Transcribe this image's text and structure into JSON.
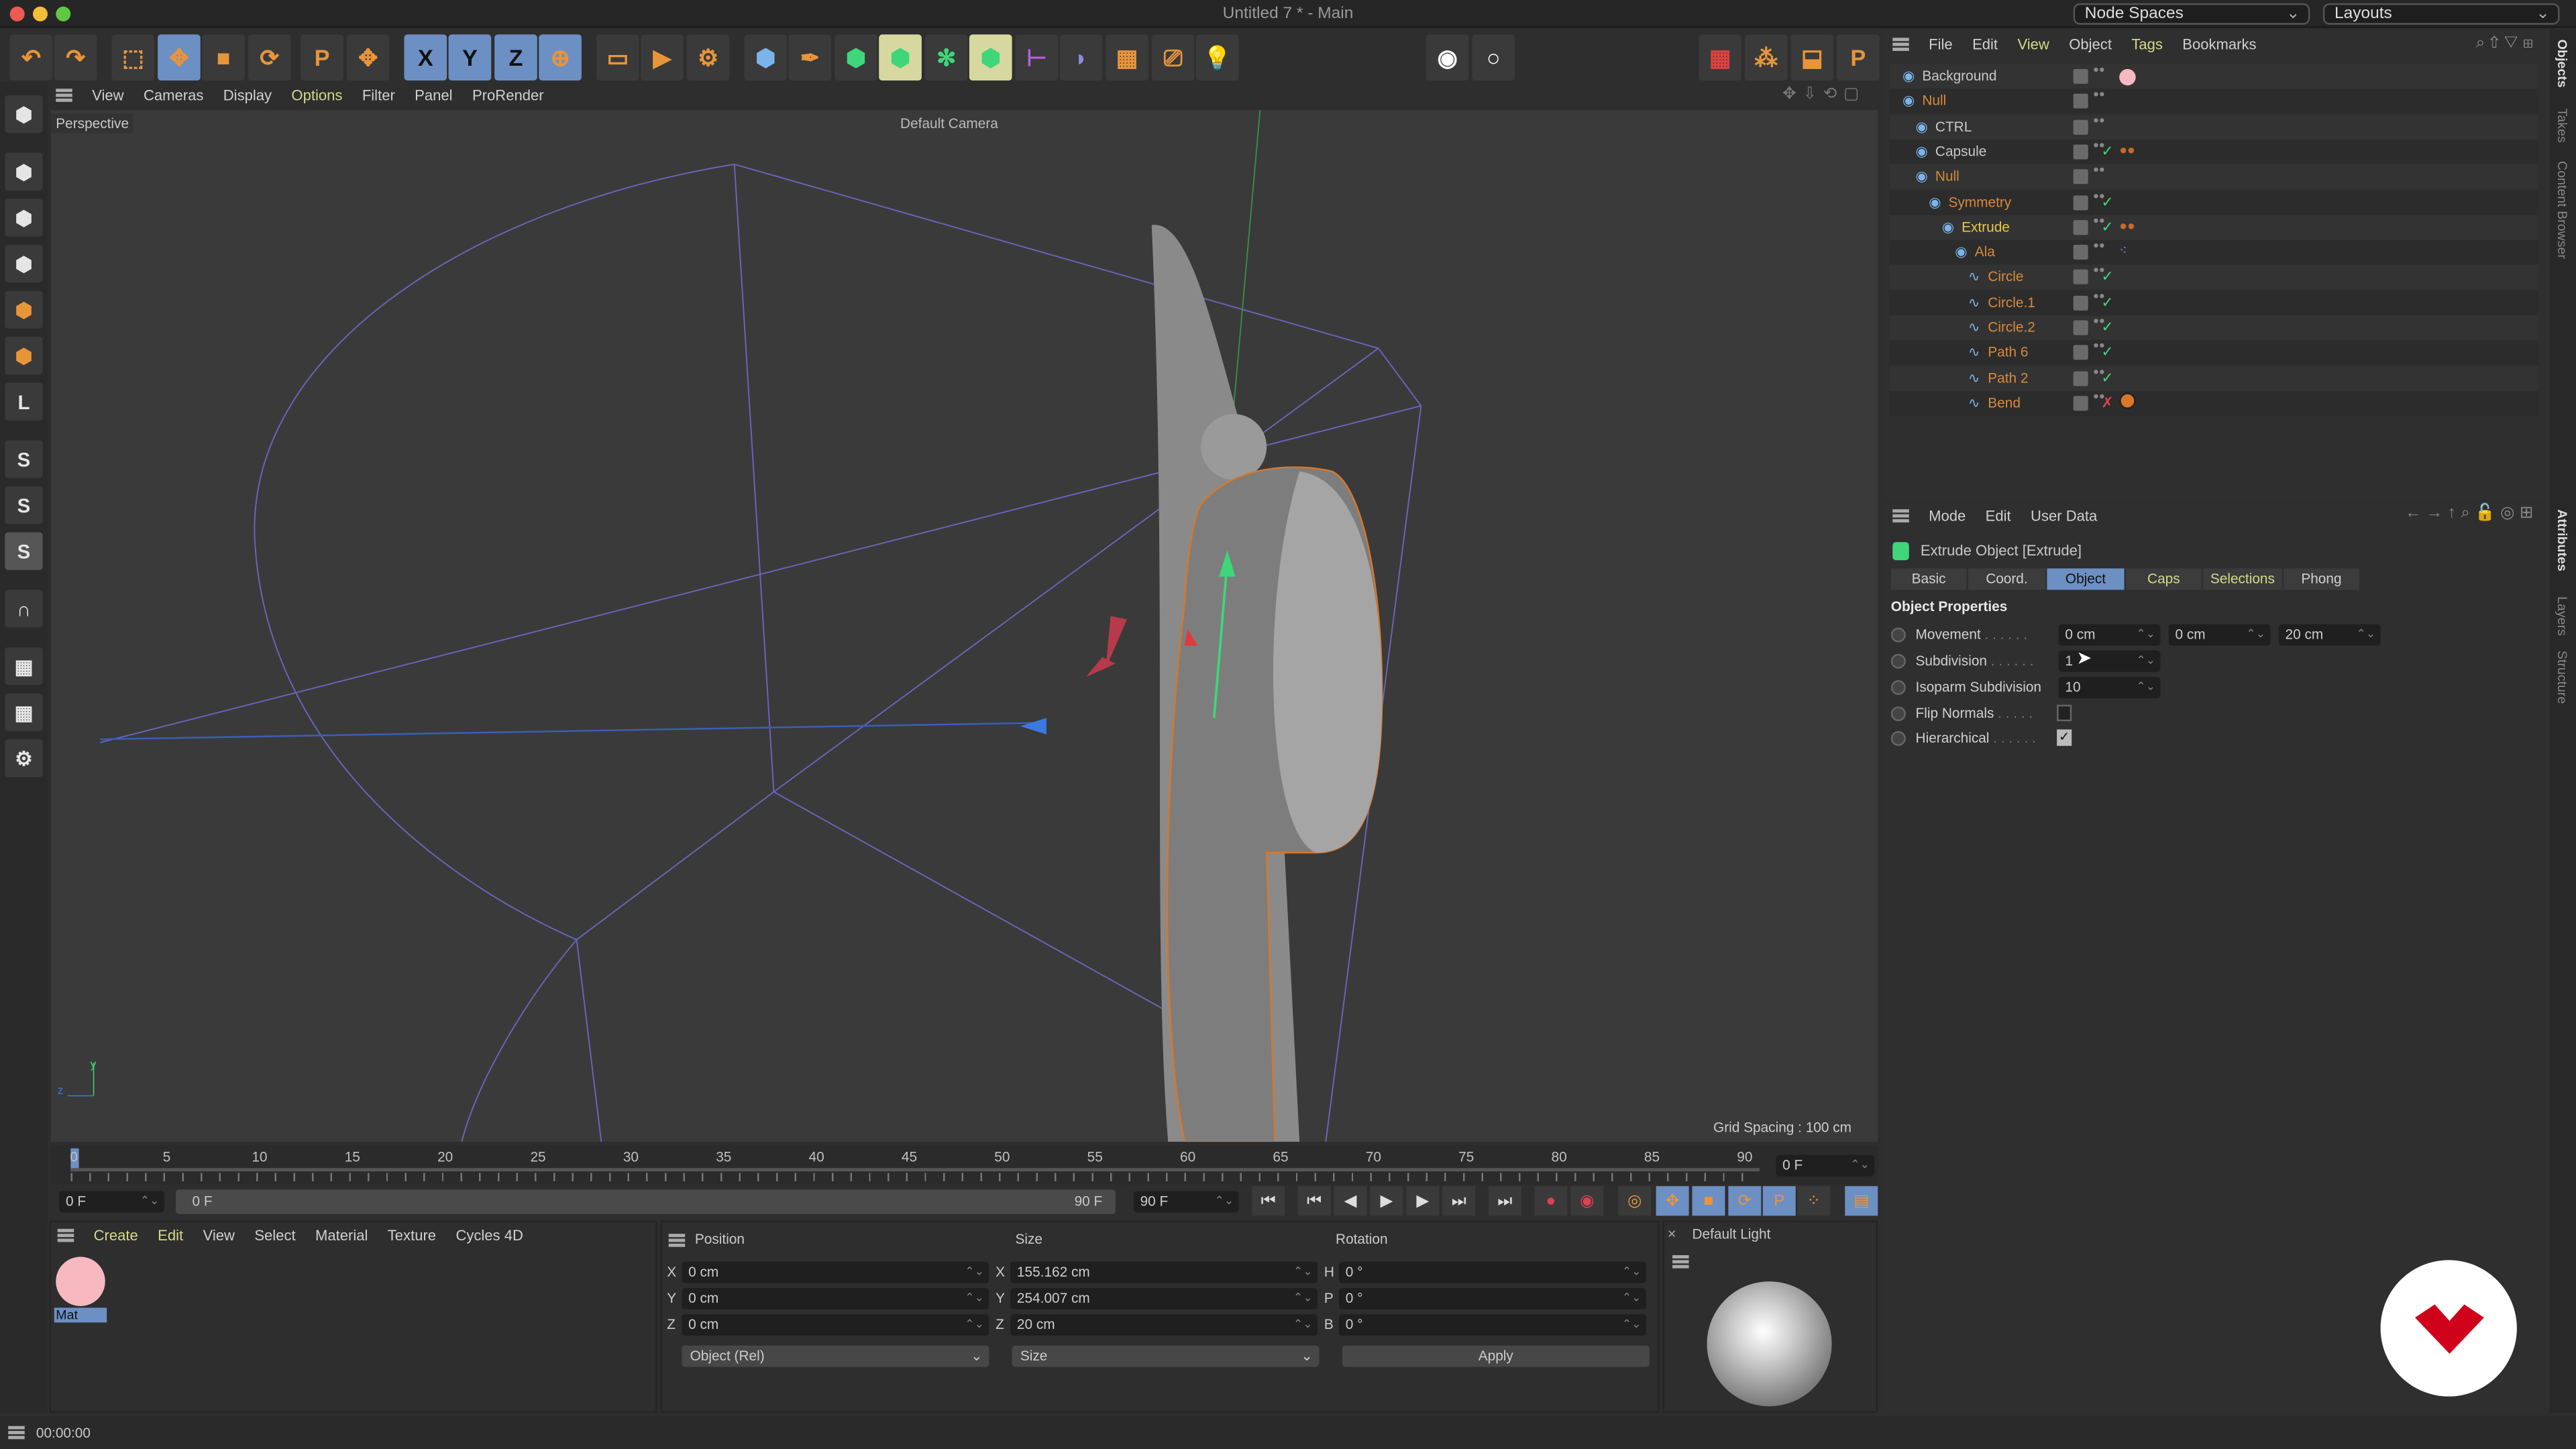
{
  "window": {
    "title": "Untitled 7 * - Main",
    "node_spaces": "Node Spaces",
    "layouts": "Layouts"
  },
  "toolbar": {
    "icons": [
      "undo-icon",
      "redo-icon",
      "select-icon",
      "move-icon",
      "scale-icon",
      "rotate-icon",
      "psr-icon",
      "transform-icon",
      "x-axis-icon",
      "y-axis-icon",
      "z-axis-icon",
      "world-coord-icon",
      "render-view-icon",
      "render-icon",
      "render-settings-icon",
      "cube-icon",
      "pen-icon",
      "subdivision-icon",
      "extrude-icon",
      "cloner-icon",
      "mograph-icon",
      "symmetry-icon",
      "deformer-icon",
      "floor-icon",
      "camera-icon",
      "light-icon",
      "snap-icon",
      "record-icon",
      "timeline-icon",
      "keys-icon",
      "coord-icon",
      "psr-reset-icon"
    ],
    "axis_labels": [
      "X",
      "Y",
      "Z"
    ]
  },
  "viewport": {
    "menu": [
      "View",
      "Cameras",
      "Display",
      "Options",
      "Filter",
      "Panel",
      "ProRender"
    ],
    "active_menu": "Options",
    "label": "Perspective",
    "camera": "Default Camera",
    "grid_spacing": "Grid Spacing : 100 cm",
    "axes": [
      "y",
      "z"
    ]
  },
  "timeline": {
    "ticks": [
      "0",
      "5",
      "10",
      "15",
      "20",
      "25",
      "30",
      "35",
      "40",
      "45",
      "50",
      "55",
      "60",
      "65",
      "70",
      "75",
      "80",
      "85",
      "90"
    ],
    "current_frame": "0 F",
    "start": "0 F",
    "range_start": "0 F",
    "range_end": "90 F",
    "end": "90 F"
  },
  "object_manager": {
    "menu": [
      "File",
      "Edit",
      "View",
      "Object",
      "Tags",
      "Bookmarks"
    ],
    "objects": [
      {
        "name": "Background",
        "depth": 0,
        "color": "#c8c8c8",
        "check": ""
      },
      {
        "name": "Null",
        "depth": 0,
        "color": "#d88a3a",
        "check": ""
      },
      {
        "name": "CTRL",
        "depth": 1,
        "color": "#c8c8c8",
        "check": ""
      },
      {
        "name": "Capsule",
        "depth": 1,
        "color": "#c8c8c8",
        "check": "✓"
      },
      {
        "name": "Null",
        "depth": 1,
        "color": "#d88a3a",
        "check": ""
      },
      {
        "name": "Symmetry",
        "depth": 2,
        "color": "#d88a3a",
        "check": "✓"
      },
      {
        "name": "Extrude",
        "depth": 3,
        "color": "#e8c84a",
        "check": "✓"
      },
      {
        "name": "Ala",
        "depth": 4,
        "color": "#d88a3a",
        "check": ""
      },
      {
        "name": "Circle",
        "depth": 5,
        "color": "#d88a3a",
        "check": "✓"
      },
      {
        "name": "Circle.1",
        "depth": 5,
        "color": "#d88a3a",
        "check": "✓"
      },
      {
        "name": "Circle.2",
        "depth": 5,
        "color": "#d88a3a",
        "check": "✓"
      },
      {
        "name": "Path 6",
        "depth": 5,
        "color": "#d88a3a",
        "check": "✓"
      },
      {
        "name": "Path 2",
        "depth": 5,
        "color": "#d88a3a",
        "check": "✓"
      },
      {
        "name": "Bend",
        "depth": 5,
        "color": "#d88a3a",
        "check": "✗"
      }
    ]
  },
  "attributes": {
    "menu": [
      "Mode",
      "Edit",
      "User Data"
    ],
    "object_title": "Extrude Object [Extrude]",
    "tabs": [
      "Basic",
      "Coord.",
      "Object",
      "Caps",
      "Selections",
      "Phong"
    ],
    "active_tab": "Object",
    "section": "Object Properties",
    "movement": {
      "label": "Movement",
      "x": "0 cm",
      "y": "0 cm",
      "z": "20 cm"
    },
    "subdivision": {
      "label": "Subdivision",
      "value": "1"
    },
    "isoparm": {
      "label": "Isoparm Subdivision",
      "value": "10"
    },
    "flip_normals": {
      "label": "Flip Normals",
      "checked": false
    },
    "hierarchical": {
      "label": "Hierarchical",
      "checked": true
    }
  },
  "side_tabs": [
    "Objects",
    "Takes",
    "Content Browser",
    "Attributes",
    "Layers",
    "Structure"
  ],
  "materials": {
    "menu": [
      "Create",
      "Edit",
      "View",
      "Select",
      "Material",
      "Texture",
      "Cycles 4D"
    ],
    "items": [
      {
        "name": "Mat",
        "color": "#f7b8c0"
      }
    ]
  },
  "coordinates": {
    "headers": [
      "Position",
      "Size",
      "Rotation"
    ],
    "position": {
      "X": "0 cm",
      "Y": "0 cm",
      "Z": "0 cm"
    },
    "size": {
      "X": "155.162 cm",
      "Y": "254.007 cm",
      "Z": "20 cm"
    },
    "rotation": {
      "H": "0 °",
      "P": "0 °",
      "B": "0 °"
    },
    "mode": "Object (Rel)",
    "size_mode": "Size",
    "apply": "Apply"
  },
  "light_preview": {
    "title": "Default Light"
  },
  "status": {
    "time": "00:00:00"
  },
  "colors": {
    "accent": "#6c8fc4",
    "selection": "#d88a3a",
    "active_object": "#e8c84a",
    "logo": "#d0021b"
  }
}
